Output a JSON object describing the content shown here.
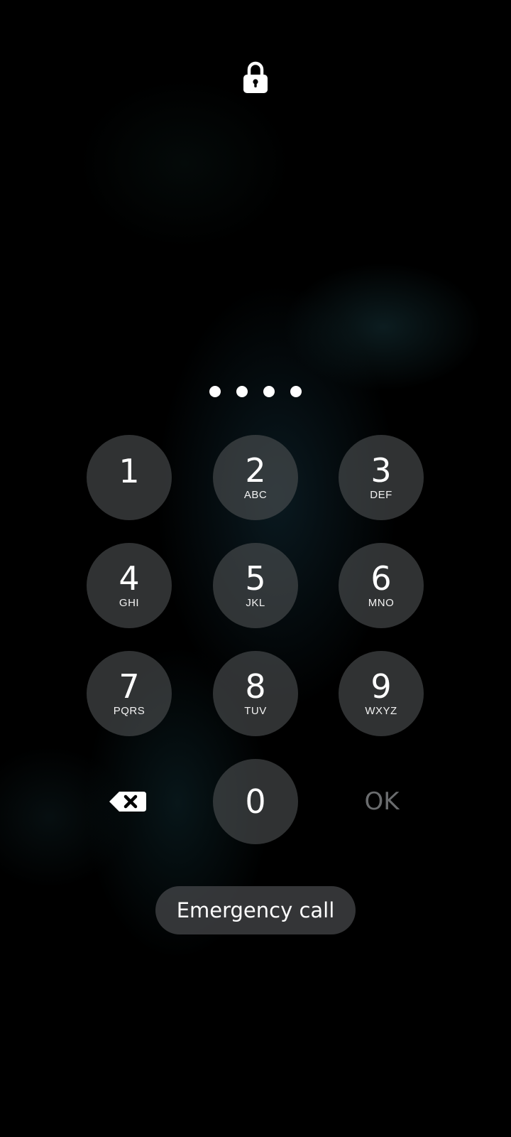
{
  "lock_screen": {
    "icon": "lock-icon",
    "pin_dots_count": 4
  },
  "keypad": {
    "keys": [
      {
        "digit": "1",
        "letters": ""
      },
      {
        "digit": "2",
        "letters": "ABC"
      },
      {
        "digit": "3",
        "letters": "DEF"
      },
      {
        "digit": "4",
        "letters": "GHI"
      },
      {
        "digit": "5",
        "letters": "JKL"
      },
      {
        "digit": "6",
        "letters": "MNO"
      },
      {
        "digit": "7",
        "letters": "PQRS"
      },
      {
        "digit": "8",
        "letters": "TUV"
      },
      {
        "digit": "9",
        "letters": "WXYZ"
      },
      {
        "digit": "0",
        "letters": ""
      }
    ],
    "backspace_icon": "backspace-icon",
    "ok_label": "OK"
  },
  "emergency_call_label": "Emergency call",
  "colors": {
    "background": "#000000",
    "key_fill": "#4e5052",
    "ok_disabled": "#6a6c6e",
    "text": "#ffffff"
  }
}
